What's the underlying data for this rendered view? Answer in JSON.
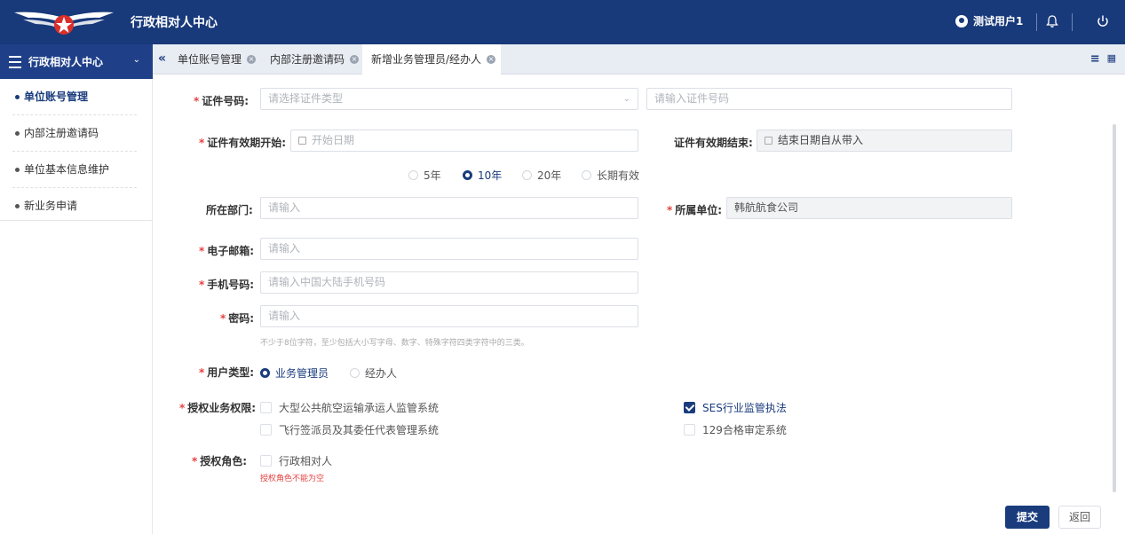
{
  "header": {
    "app_title": "行政相对人中心",
    "user_name": "测试用户1",
    "icons": [
      "logo-emblem",
      "user-icon",
      "bell-icon",
      "power-icon"
    ]
  },
  "sidebar": {
    "title": "行政相对人中心",
    "items": [
      {
        "label": "单位账号管理",
        "active": true
      },
      {
        "label": "内部注册邀请码"
      },
      {
        "label": "单位基本信息维护"
      },
      {
        "label": "新业务申请"
      }
    ]
  },
  "tabs": [
    {
      "label": "单位账号管理"
    },
    {
      "label": "内部注册邀请码"
    },
    {
      "label": "新增业务管理员/经办人",
      "active": true
    }
  ],
  "form": {
    "id_number": {
      "label": "证件号码:",
      "type_placeholder": "请选择证件类型",
      "number_placeholder": "请输入证件号码"
    },
    "valid_start": {
      "label": "证件有效期开始:",
      "placeholder": "开始日期"
    },
    "valid_end": {
      "label": "证件有效期结束:",
      "placeholder": "结束日期自从带入"
    },
    "period_options": [
      {
        "label": "5年",
        "checked": false
      },
      {
        "label": "10年",
        "checked": true
      },
      {
        "label": "20年",
        "checked": false
      },
      {
        "label": "长期有效",
        "checked": false
      }
    ],
    "department": {
      "label": "所在部门:",
      "placeholder": "请输入"
    },
    "company": {
      "label": "所属单位:",
      "value": "韩航航食公司"
    },
    "email": {
      "label": "电子邮箱:",
      "placeholder": "请输入"
    },
    "phone": {
      "label": "手机号码:",
      "placeholder": "请输入中国大陆手机号码"
    },
    "password": {
      "label": "密码:",
      "placeholder": "请输入",
      "hint": "不少于8位字符，至少包括大小写字母、数字、特殊字符四类字符中的三类。"
    },
    "user_type": {
      "label": "用户类型:",
      "options": [
        {
          "label": "业务管理员",
          "checked": true
        },
        {
          "label": "经办人",
          "checked": false
        }
      ]
    },
    "permissions": {
      "label": "授权业务权限:",
      "options": [
        {
          "label": "大型公共航空运输承运人监管系统",
          "checked": false
        },
        {
          "label": "SES行业监管执法",
          "checked": true
        },
        {
          "label": "飞行签派员及其委任代表管理系统",
          "checked": false
        },
        {
          "label": "129合格审定系统",
          "checked": false
        }
      ]
    },
    "role": {
      "label": "授权角色:",
      "options": [
        {
          "label": "行政相对人",
          "checked": false
        }
      ],
      "error": "授权角色不能为空"
    },
    "submit_label": "提交",
    "back_label": "返回"
  },
  "colors": {
    "primary": "#1a3c7d",
    "header_bg": "#18397a",
    "required": "#e64242"
  }
}
